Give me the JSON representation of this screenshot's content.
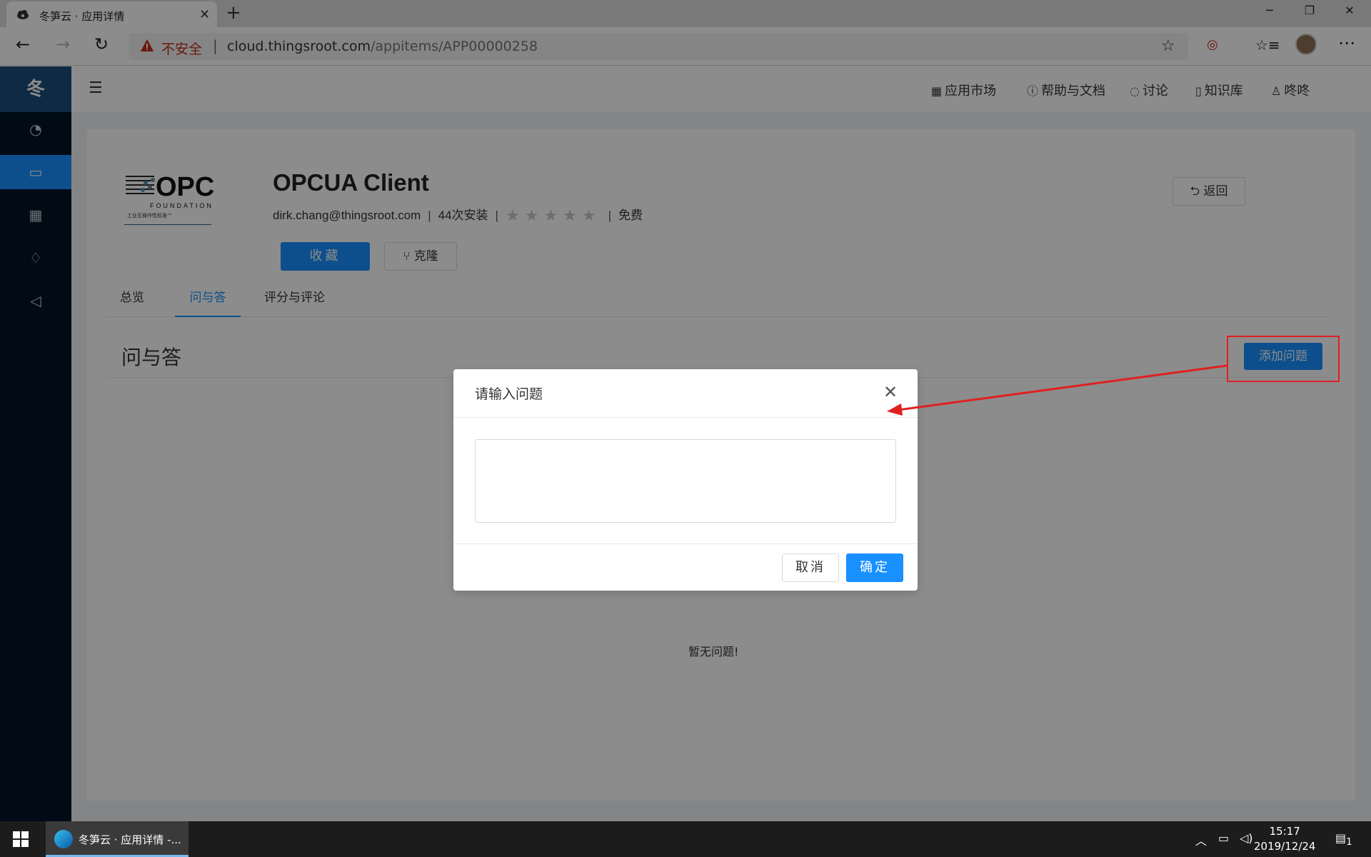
{
  "browser": {
    "tab_title": "冬笋云 · 应用详情",
    "insecure_label": "不安全",
    "url_host": "cloud.thingsroot.com",
    "url_path": "/appitems/APP00000258"
  },
  "sidebar": {
    "logo": "冬",
    "items": [
      {
        "icon": "dashboard-icon"
      },
      {
        "icon": "laptop-icon",
        "active": true
      },
      {
        "icon": "apps-grid-icon"
      },
      {
        "icon": "bell-icon"
      },
      {
        "icon": "megaphone-icon"
      }
    ]
  },
  "topnav": {
    "app_market": "应用市场",
    "help_docs": "帮助与文档",
    "discuss": "讨论",
    "knowledge": "知识库",
    "user": "咚咚"
  },
  "app": {
    "logo_text": "OPC",
    "logo_sub": "FOUNDATION",
    "logo_caption": "工业互操作性标准™",
    "name": "OPCUA Client",
    "author": "dirk.chang@thingsroot.com",
    "installs": "44次安装",
    "price": "免费",
    "rating_stars": 0,
    "favorite_btn": "收藏",
    "clone_btn": "克隆",
    "back_btn": "返回"
  },
  "tabs": [
    {
      "label": "总览"
    },
    {
      "label": "问与答",
      "active": true
    },
    {
      "label": "评分与评论"
    }
  ],
  "qa": {
    "title": "问与答",
    "add_btn": "添加问题",
    "empty_text": "暂无问题!"
  },
  "modal": {
    "title": "请输入问题",
    "textarea_value": "",
    "cancel": "取消",
    "ok": "确定"
  },
  "taskbar": {
    "app_label": "冬笋云 · 应用详情 -...",
    "time": "15:17",
    "date": "2019/12/24",
    "notification_count": "1"
  },
  "colors": {
    "primary": "#1890ff",
    "sidebar": "#001529",
    "annotation": "#e02020"
  }
}
